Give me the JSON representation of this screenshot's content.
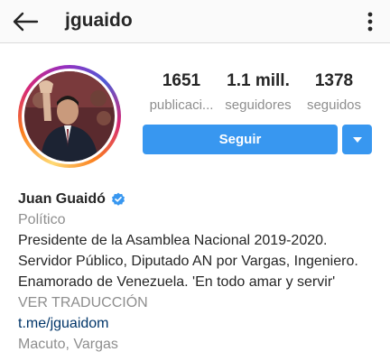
{
  "header": {
    "username": "jguaido"
  },
  "profile": {
    "stats": [
      {
        "value": "1651",
        "label": "publicaci..."
      },
      {
        "value": "1.1 mill.",
        "label": "seguidores"
      },
      {
        "value": "1378",
        "label": "seguidos"
      }
    ],
    "follow_label": "Seguir",
    "full_name": "Juan Guaidó",
    "category": "Político",
    "bio_lines": [
      "Presidente de la Asamblea Nacional 2019-2020.",
      "Servidor Público, Diputado AN por Vargas, Ingeniero.",
      "Enamorado de Venezuela. 'En todo amar y servir'"
    ],
    "translate_label": "VER TRADUCCIÓN",
    "link": "t.me/jguaidom",
    "location": "Macuto, Vargas"
  },
  "colors": {
    "accent": "#3897f0",
    "verified": "#3897f0",
    "muted": "#8e8e8e",
    "link": "#003569"
  },
  "icons": {
    "back": "arrow-left-icon",
    "more": "more-vertical-icon",
    "verified": "verified-badge-icon",
    "dropdown": "chevron-down-icon"
  }
}
